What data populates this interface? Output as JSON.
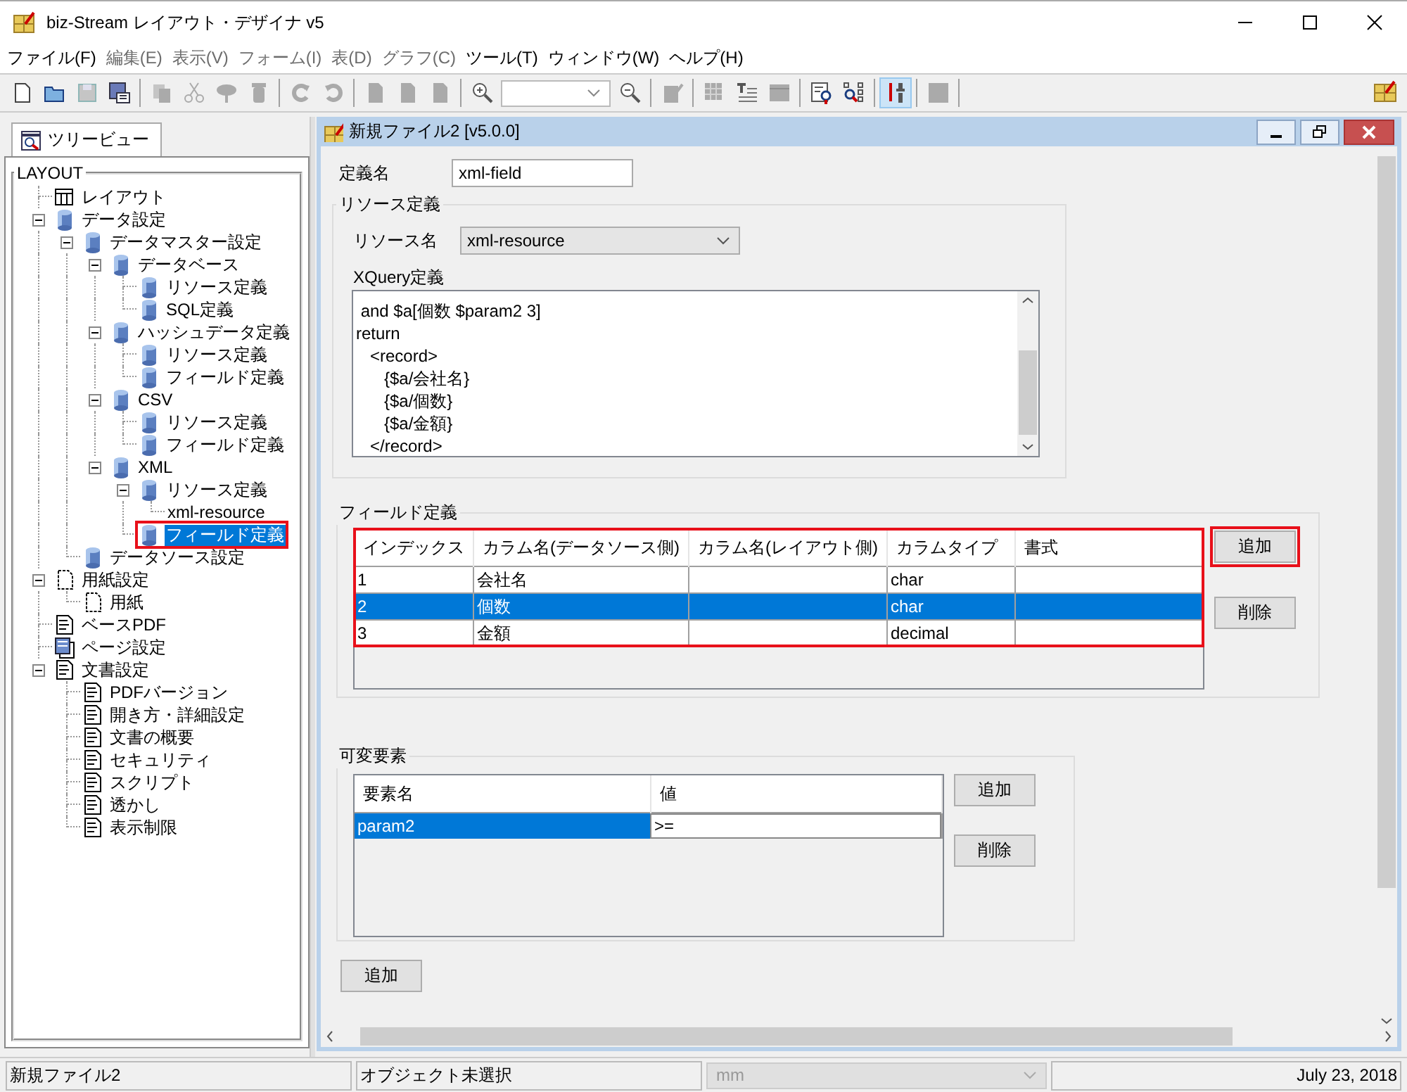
{
  "window": {
    "title": "biz-Stream レイアウト・デザイナ v5"
  },
  "menu": [
    {
      "label": "ファイル(F)",
      "disabled": false
    },
    {
      "label": "編集(E)",
      "disabled": true
    },
    {
      "label": "表示(V)",
      "disabled": true
    },
    {
      "label": "フォーム(I)",
      "disabled": true
    },
    {
      "label": "表(D)",
      "disabled": true
    },
    {
      "label": "グラフ(C)",
      "disabled": true
    },
    {
      "label": "ツール(T)",
      "disabled": false
    },
    {
      "label": "ウィンドウ(W)",
      "disabled": false
    },
    {
      "label": "ヘルプ(H)",
      "disabled": false
    }
  ],
  "toolbar": [
    {
      "kind": "new",
      "disabled": false,
      "pressed": false
    },
    {
      "kind": "open",
      "disabled": false,
      "pressed": false
    },
    {
      "kind": "save",
      "disabled": true,
      "pressed": false
    },
    {
      "kind": "saveas",
      "disabled": false,
      "pressed": false
    },
    {
      "kind": "separator"
    },
    {
      "kind": "copy",
      "disabled": true,
      "pressed": false
    },
    {
      "kind": "cut",
      "disabled": true,
      "pressed": false
    },
    {
      "kind": "pin",
      "disabled": true,
      "pressed": false
    },
    {
      "kind": "trash",
      "disabled": true,
      "pressed": false
    },
    {
      "kind": "separator"
    },
    {
      "kind": "redo",
      "disabled": true,
      "pressed": false
    },
    {
      "kind": "undo",
      "disabled": true,
      "pressed": false
    },
    {
      "kind": "separator"
    },
    {
      "kind": "page",
      "disabled": true,
      "pressed": false
    },
    {
      "kind": "page",
      "disabled": true,
      "pressed": false
    },
    {
      "kind": "page",
      "disabled": true,
      "pressed": false
    },
    {
      "kind": "separator"
    },
    {
      "kind": "zoomin",
      "disabled": false,
      "pressed": false
    },
    {
      "kind": "combo"
    },
    {
      "kind": "zoomout",
      "disabled": false,
      "pressed": false
    },
    {
      "kind": "separator"
    },
    {
      "kind": "edit",
      "disabled": true,
      "pressed": false
    },
    {
      "kind": "separator"
    },
    {
      "kind": "grid",
      "disabled": true,
      "pressed": false
    },
    {
      "kind": "text",
      "disabled": false,
      "pressed": false
    },
    {
      "kind": "table",
      "disabled": true,
      "pressed": false
    },
    {
      "kind": "separator"
    },
    {
      "kind": "preview",
      "disabled": false,
      "pressed": false
    },
    {
      "kind": "treesearch",
      "disabled": false,
      "pressed": false
    },
    {
      "kind": "separator"
    },
    {
      "kind": "tools",
      "disabled": false,
      "pressed": true
    },
    {
      "kind": "separator"
    },
    {
      "kind": "stop",
      "disabled": true,
      "pressed": false
    },
    {
      "kind": "separator"
    }
  ],
  "tree_view": {
    "tab": "ツリービュー",
    "group": "LAYOUT",
    "items": [
      {
        "label": "レイアウト",
        "kind": "layout",
        "selected": false,
        "highlighted": false
      },
      {
        "label": "データ設定",
        "kind": "db",
        "expanded": true,
        "selected": false,
        "highlighted": false,
        "children": [
          {
            "label": "データマスター設定",
            "kind": "db",
            "expanded": true,
            "selected": false,
            "highlighted": false,
            "children": [
              {
                "label": "データベース",
                "kind": "db",
                "expanded": true,
                "selected": false,
                "highlighted": false,
                "children": [
                  {
                    "label": "リソース定義",
                    "kind": "db",
                    "selected": false,
                    "highlighted": false
                  },
                  {
                    "label": "SQL定義",
                    "kind": "db",
                    "selected": false,
                    "highlighted": false
                  }
                ]
              },
              {
                "label": "ハッシュデータ定義",
                "kind": "db",
                "expanded": true,
                "selected": false,
                "highlighted": false,
                "children": [
                  {
                    "label": "リソース定義",
                    "kind": "db",
                    "selected": false,
                    "highlighted": false
                  },
                  {
                    "label": "フィールド定義",
                    "kind": "db",
                    "selected": false,
                    "highlighted": false
                  }
                ]
              },
              {
                "label": "CSV",
                "kind": "db",
                "expanded": true,
                "selected": false,
                "highlighted": false,
                "children": [
                  {
                    "label": "リソース定義",
                    "kind": "db",
                    "selected": false,
                    "highlighted": false
                  },
                  {
                    "label": "フィールド定義",
                    "kind": "db",
                    "selected": false,
                    "highlighted": false
                  }
                ]
              },
              {
                "label": "XML",
                "kind": "db",
                "expanded": true,
                "selected": false,
                "highlighted": false,
                "children": [
                  {
                    "label": "リソース定義",
                    "kind": "db",
                    "expanded": true,
                    "selected": false,
                    "highlighted": false,
                    "children": [
                      {
                        "label": "xml-resource",
                        "selected": false,
                        "highlighted": false
                      }
                    ]
                  },
                  {
                    "label": "フィールド定義",
                    "kind": "db",
                    "selected": true,
                    "highlighted": true
                  }
                ]
              }
            ]
          },
          {
            "label": "データソース設定",
            "kind": "db",
            "selected": false,
            "highlighted": false
          }
        ]
      },
      {
        "label": "用紙設定",
        "kind": "paper",
        "expanded": true,
        "selected": false,
        "highlighted": false,
        "children": [
          {
            "label": "用紙",
            "kind": "paper",
            "selected": false,
            "highlighted": false
          }
        ]
      },
      {
        "label": "ベースPDF",
        "kind": "doc",
        "selected": false,
        "highlighted": false
      },
      {
        "label": "ページ設定",
        "kind": "pages",
        "selected": false,
        "highlighted": false
      },
      {
        "label": "文書設定",
        "kind": "doc",
        "expanded": true,
        "selected": false,
        "highlighted": false,
        "children": [
          {
            "label": "PDFバージョン",
            "kind": "doc",
            "selected": false,
            "highlighted": false
          },
          {
            "label": "開き方・詳細設定",
            "kind": "doc",
            "selected": false,
            "highlighted": false
          },
          {
            "label": "文書の概要",
            "kind": "doc",
            "selected": false,
            "highlighted": false
          },
          {
            "label": "セキュリティ",
            "kind": "doc",
            "selected": false,
            "highlighted": false
          },
          {
            "label": "スクリプト",
            "kind": "doc",
            "selected": false,
            "highlighted": false
          },
          {
            "label": "透かし",
            "kind": "doc",
            "selected": false,
            "highlighted": false
          },
          {
            "label": "表示制限",
            "kind": "doc",
            "selected": false,
            "highlighted": false
          }
        ]
      }
    ]
  },
  "document": {
    "title": "新規ファイル2 [v5.0.0]",
    "definition_name": {
      "label": "定義名",
      "value": "xml-field"
    },
    "resource": {
      "title": "リソース定義",
      "name_label": "リソース名",
      "name_value": "xml-resource",
      "xquery_label": "XQuery定義",
      "xquery_lines": [
        " and $a[個数 $param2 3]",
        "return",
        "   <record>",
        "      {$a/会社名}",
        "      {$a/個数}",
        "      {$a/金額}",
        "   </record>"
      ]
    },
    "fields": {
      "title": "フィールド定義",
      "highlighted": true,
      "columns": [
        "インデックス",
        "カラム名(データソース側)",
        "カラム名(レイアウト側)",
        "カラムタイプ",
        "書式"
      ],
      "rows": [
        {
          "cells": [
            "1",
            "会社名",
            "",
            "char",
            ""
          ],
          "selected": false
        },
        {
          "cells": [
            "2",
            "個数",
            "",
            "char",
            ""
          ],
          "selected": true
        },
        {
          "cells": [
            "3",
            "金額",
            "",
            "decimal",
            ""
          ],
          "selected": false
        }
      ],
      "buttons": [
        {
          "label": "追加",
          "highlighted": true
        },
        {
          "label": "削除",
          "highlighted": false
        }
      ]
    },
    "variables": {
      "title": "可変要素",
      "columns": [
        "要素名",
        "値"
      ],
      "rows": [
        {
          "cells": [
            "param2",
            ">="
          ],
          "selected": true,
          "editing": true
        }
      ],
      "buttons": [
        {
          "label": "追加",
          "highlighted": false
        },
        {
          "label": "削除",
          "highlighted": false
        }
      ]
    },
    "add_button": "追加"
  },
  "status_bar": {
    "file": "新規ファイル2",
    "selection": "オブジェクト未選択",
    "unit": {
      "value": "mm",
      "disabled": true
    },
    "date": "July 23, 2018"
  }
}
